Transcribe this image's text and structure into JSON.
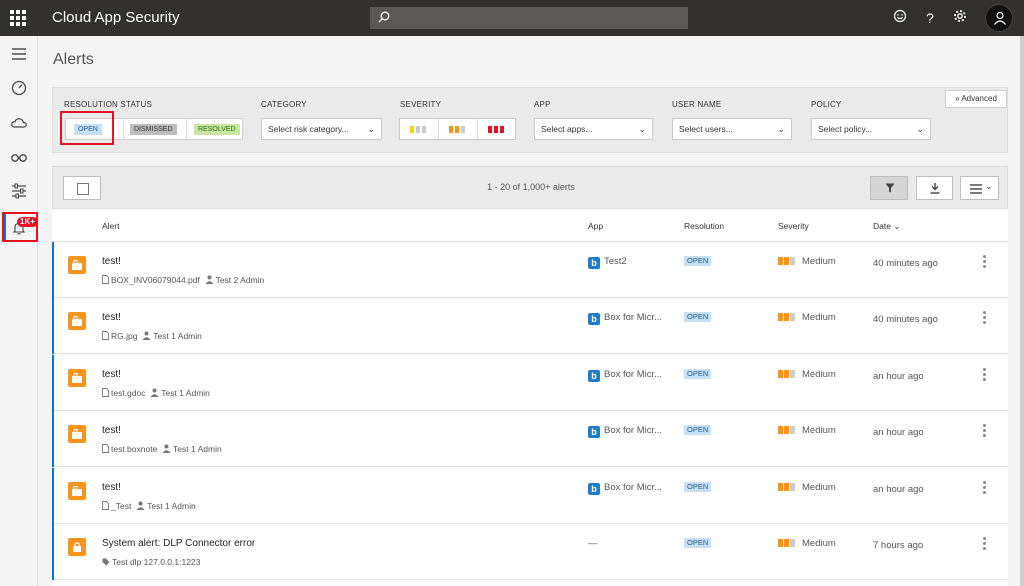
{
  "app": {
    "title": "Cloud App Security",
    "search_placeholder": ""
  },
  "topbar": {
    "icons": [
      "smiley-icon",
      "help-icon",
      "settings-icon",
      "user-icon"
    ],
    "help_glyph": "?"
  },
  "sidebar": {
    "items": [
      "menu-icon",
      "dashboard-icon",
      "cloud-icon",
      "investigate-icon",
      "control-icon",
      "alerts-icon"
    ],
    "alerts_badge": "1K+"
  },
  "page": {
    "title": "Alerts"
  },
  "filters": {
    "resolution_status": {
      "label": "RESOLUTION STATUS",
      "open": "OPEN",
      "dismissed": "DISMISSED",
      "resolved": "RESOLVED"
    },
    "category": {
      "label": "CATEGORY",
      "placeholder": "Select risk category..."
    },
    "severity": {
      "label": "SEVERITY"
    },
    "app": {
      "label": "APP",
      "placeholder": "Select apps..."
    },
    "user_name": {
      "label": "USER NAME",
      "placeholder": "Select users..."
    },
    "policy": {
      "label": "POLICY",
      "placeholder": "Select policy..."
    },
    "advanced": "Advanced"
  },
  "toolbar": {
    "count_text": "1 - 20 of 1,000+ alerts"
  },
  "table": {
    "columns": {
      "alert": "Alert",
      "app": "App",
      "resolution": "Resolution",
      "severity": "Severity",
      "date": "Date"
    },
    "rows": [
      {
        "title": "test!",
        "file": "BOX_INV06079044.pdf",
        "user": "Test 2 Admin",
        "app": "Test2",
        "resolution": "OPEN",
        "severity": "Medium",
        "date": "40 minutes ago"
      },
      {
        "title": "test!",
        "file": "RG.jpg",
        "user": "Test 1 Admin",
        "app": "Box for Micr...",
        "resolution": "OPEN",
        "severity": "Medium",
        "date": "40 minutes ago"
      },
      {
        "title": "test!",
        "file": "test.gdoc",
        "user": "Test 1 Admin",
        "app": "Box for Micr...",
        "resolution": "OPEN",
        "severity": "Medium",
        "date": "an hour ago"
      },
      {
        "title": "test!",
        "file": "test.boxnote",
        "user": "Test 1 Admin",
        "app": "Box for Micr...",
        "resolution": "OPEN",
        "severity": "Medium",
        "date": "an hour ago"
      },
      {
        "title": "test!",
        "file": "_Test",
        "user": "Test 1 Admin",
        "app": "Box for Micr...",
        "resolution": "OPEN",
        "severity": "Medium",
        "date": "an hour ago"
      },
      {
        "title": "System alert: DLP Connector error",
        "file": "Test dlp 127.0.0.1:1223",
        "user": "",
        "app": "—",
        "resolution": "OPEN",
        "severity": "Medium",
        "date": "7 hours ago"
      }
    ]
  },
  "colors": {
    "accent": "#0078d4",
    "severity_medium": "#f7941d",
    "severity_high": "#e81123",
    "severity_low": "#fcd116",
    "open_chip": "#c7e0f4",
    "resolved_chip": "#c8e6a0"
  }
}
